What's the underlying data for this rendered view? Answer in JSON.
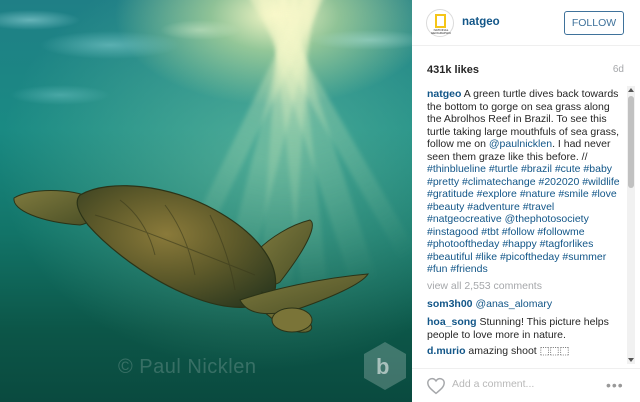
{
  "photo": {
    "watermark": "© Paul Nicklen"
  },
  "header": {
    "avatar_text": "NATIONAL GEOGRAPHIC",
    "username": "natgeo",
    "follow_label": "FOLLOW"
  },
  "stats": {
    "likes": "431k likes",
    "age": "6d"
  },
  "caption": {
    "user": "natgeo",
    "text_a": " A green turtle dives back towards the bottom to gorge on sea grass along the Abrolhos Reef in Brazil. To see this turtle taking large mouthfuls of sea grass, follow me on ",
    "mention": "@paulnicklen",
    "text_b": ". I had never seen them graze like this before. // ",
    "hashtags": "#thinblueline #turtle #brazil #cute #baby #pretty #climatechange #202020 #wildlife #gratitude #explore #nature #smile #love #beauty #adventure #travel #natgeocreative @thephotosociety #instagood #tbt #follow #followme #photooftheday #happy #tagforlikes #beautiful #like #picoftheday #summer #fun #friends"
  },
  "view_all": "view all 2,553 comments",
  "comments": [
    {
      "user": "som3h00",
      "text": "",
      "mention": "@anas_alomary"
    },
    {
      "user": "hoa_song",
      "text": " Stunning! This picture helps people to love more in nature.",
      "mention": ""
    },
    {
      "user": "d.murio",
      "text": " amazing shoot ",
      "mention": "",
      "emoji": "⬚⬚⬚"
    }
  ],
  "footer": {
    "comment_placeholder": "Add a comment...",
    "more_label": "•••"
  },
  "colors": {
    "link": "#125688",
    "follow_border": "#3f729b",
    "muted": "#a5a7aa"
  }
}
